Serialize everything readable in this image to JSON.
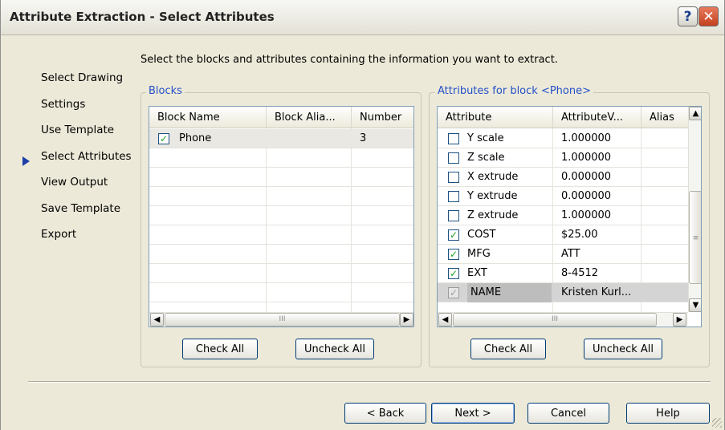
{
  "window": {
    "title": "Attribute Extraction - Select Attributes",
    "help_label": "?",
    "close_label": "✕"
  },
  "nav": {
    "items": [
      {
        "label": "Select Drawing"
      },
      {
        "label": "Settings"
      },
      {
        "label": "Use Template"
      },
      {
        "label": "Select Attributes",
        "current": true
      },
      {
        "label": "View Output"
      },
      {
        "label": "Save Template"
      },
      {
        "label": "Export"
      }
    ]
  },
  "instruction": "Select the blocks and attributes containing the information you want to extract.",
  "blocks": {
    "label": "Blocks",
    "columns": [
      "Block Name",
      "Block Alia...",
      "Number"
    ],
    "rows": [
      {
        "checked": true,
        "name": "Phone",
        "alias": "",
        "number": "3"
      }
    ],
    "check_all": "Check All",
    "uncheck_all": "Uncheck All"
  },
  "attributes": {
    "label": "Attributes for block <Phone>",
    "columns": [
      "Attribute",
      "AttributeV...",
      "Alias"
    ],
    "rows": [
      {
        "checked": false,
        "name": "Y scale",
        "value": "1.000000"
      },
      {
        "checked": false,
        "name": "Z scale",
        "value": "1.000000"
      },
      {
        "checked": false,
        "name": "X extrude",
        "value": "0.000000"
      },
      {
        "checked": false,
        "name": "Y extrude",
        "value": "0.000000"
      },
      {
        "checked": false,
        "name": "Z extrude",
        "value": "1.000000"
      },
      {
        "checked": true,
        "name": "COST",
        "value": "$25.00"
      },
      {
        "checked": true,
        "name": "MFG",
        "value": "ATT"
      },
      {
        "checked": true,
        "name": "EXT",
        "value": "8-4512"
      },
      {
        "checked": true,
        "name": "NAME",
        "value": "Kristen Kurl...",
        "selected": true
      }
    ],
    "check_all": "Check All",
    "uncheck_all": "Uncheck All"
  },
  "footer": {
    "back": "< Back",
    "next": "Next >",
    "cancel": "Cancel",
    "help": "Help"
  },
  "scroll_glyph": "III",
  "check_glyph": "✓",
  "colors": {
    "nav_arrow": "#1d3fa6",
    "group_label": "#2350c8",
    "check": "#21a121",
    "close": "#c4411e"
  }
}
